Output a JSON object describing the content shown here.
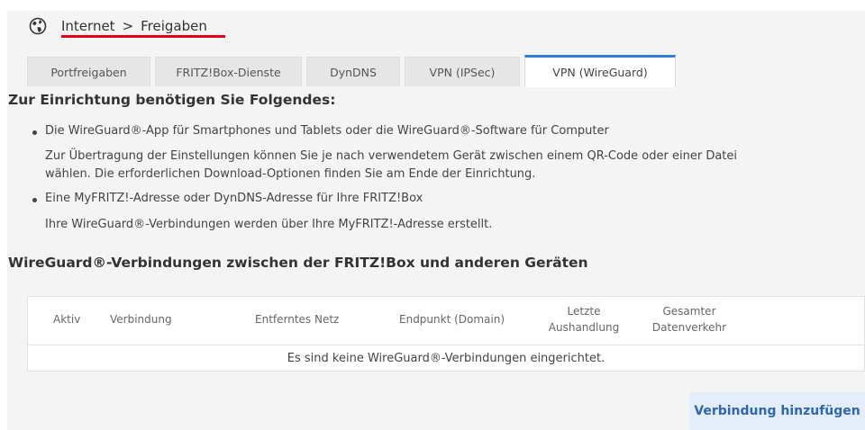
{
  "breadcrumb": {
    "parent": "Internet",
    "separator": ">",
    "current": "Freigaben",
    "icon": "globe-icon"
  },
  "tabs": [
    {
      "label": "Portfreigaben",
      "active": false
    },
    {
      "label": "FRITZ!Box-Dienste",
      "active": false
    },
    {
      "label": "DynDNS",
      "active": false
    },
    {
      "label": "VPN (IPSec)",
      "active": false
    },
    {
      "label": "VPN (WireGuard)",
      "active": true
    }
  ],
  "requirements": {
    "title": "Zur Einrichtung benötigen Sie Folgendes:",
    "items": [
      {
        "bullet": "Die WireGuard®-App für Smartphones und Tablets oder die WireGuard®-Software für Computer",
        "text_lines": [
          "Zur Übertragung der Einstellungen können Sie je nach verwendetem Gerät zwischen einem QR-Code oder einer Datei",
          "wählen. Die erforderlichen Download-Optionen finden Sie am Ende der Einrichtung."
        ]
      },
      {
        "bullet": "Eine MyFRITZ!-Adresse oder DynDNS-Adresse für Ihre FRITZ!Box",
        "text_lines": [
          "Ihre WireGuard®-Verbindungen werden über Ihre MyFRITZ!-Adresse erstellt."
        ]
      }
    ]
  },
  "connections": {
    "title": "WireGuard®-Verbindungen zwischen der FRITZ!Box und anderen Geräten",
    "columns": {
      "aktiv": "Aktiv",
      "verbindung": "Verbindung",
      "netz": "Entferntes Netz",
      "endpunkt": "Endpunkt (Domain)",
      "letzte_1": "Letzte",
      "letzte_2": "Aushandlung",
      "gesamt_1": "Gesamter",
      "gesamt_2": "Datenverkehr"
    },
    "empty_message": "Es sind keine WireGuard®-Verbindungen eingerichtet."
  },
  "add_button": "Verbindung hinzufügen",
  "colors": {
    "accent": "#2f7fd3",
    "underline": "#e2001a",
    "button_bg": "#e4eef9",
    "button_text": "#2e67b1"
  }
}
